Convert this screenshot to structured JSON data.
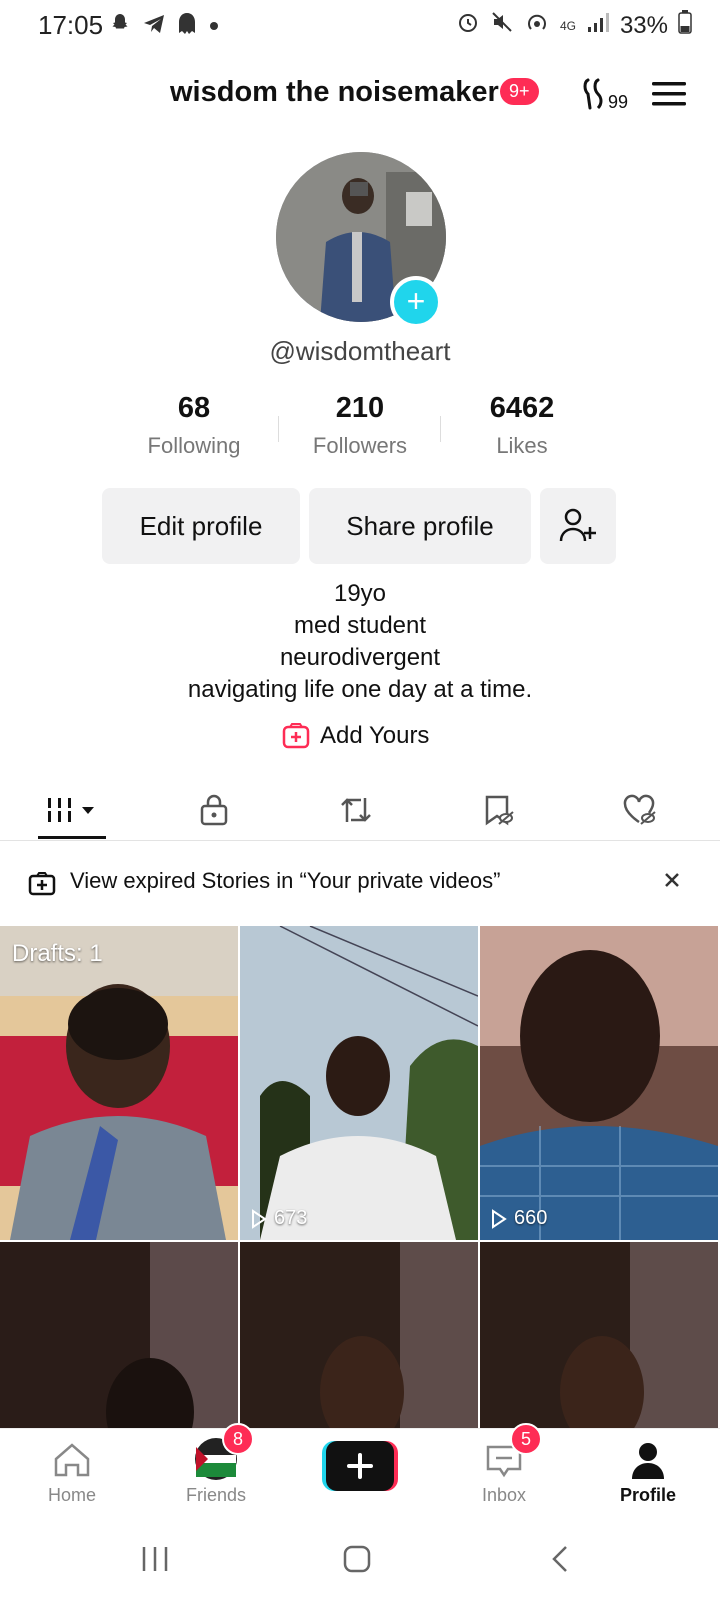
{
  "status_bar": {
    "time": "17:05",
    "network": "4G",
    "battery": "33%",
    "icons": [
      "snapchat-icon",
      "telegram-icon",
      "ghost-icon",
      "dot-icon",
      "alarm-icon",
      "mute-icon",
      "hotspot-icon",
      "signal-icon",
      "battery-icon"
    ]
  },
  "header": {
    "title": "wisdom the noisemaker",
    "badge": "9+",
    "icon_count": "99"
  },
  "profile": {
    "handle": "@wisdomtheart",
    "stats": [
      {
        "value": "68",
        "label": "Following"
      },
      {
        "value": "210",
        "label": "Followers"
      },
      {
        "value": "6462",
        "label": "Likes"
      }
    ],
    "buttons": {
      "edit": "Edit profile",
      "share": "Share profile"
    },
    "bio": [
      "19yo",
      "med student",
      "neurodivergent",
      "navigating life one day at a time."
    ],
    "add_yours": "Add Yours"
  },
  "tabs": [
    "videos-grid",
    "private-lock",
    "reposts",
    "favorites-hidden",
    "liked-hidden"
  ],
  "banner": {
    "text": "View expired Stories in “Your private videos”"
  },
  "grid": {
    "drafts_label": "Drafts: 1",
    "views": [
      "673",
      "660"
    ]
  },
  "bottom_nav": {
    "home": "Home",
    "friends": "Friends",
    "friends_badge": "8",
    "inbox": "Inbox",
    "inbox_badge": "5",
    "profile": "Profile"
  },
  "colors": {
    "accent": "#fe2c55",
    "cyan": "#20d5ec"
  }
}
